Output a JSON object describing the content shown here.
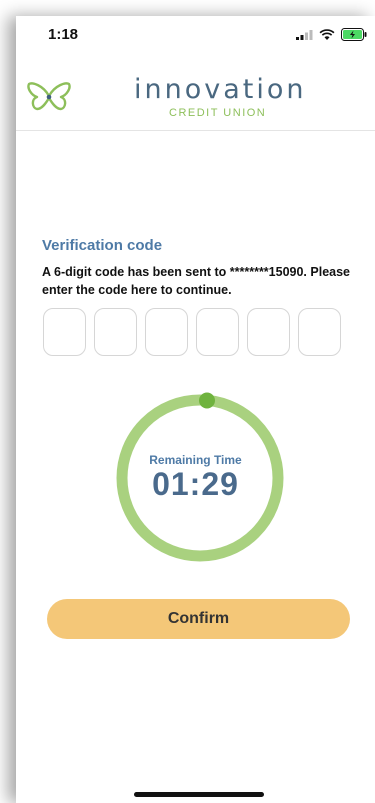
{
  "status": {
    "time": "1:18"
  },
  "brand": {
    "name": "innovation",
    "tagline": "CREDIT UNION",
    "colors": {
      "accent_green": "#8dbf5a",
      "navy": "#4a6880"
    }
  },
  "verification": {
    "title": "Verification code",
    "message": "A 6-digit code has been sent to ********15090. Please enter the code here to continue.",
    "digits": [
      "",
      "",
      "",
      "",
      "",
      ""
    ]
  },
  "timer": {
    "label": "Remaining Time",
    "value": "01:29",
    "ring_color": "#a9d17f",
    "knob_color": "#6fb33e"
  },
  "actions": {
    "confirm_label": "Confirm",
    "confirm_color": "#f4c778"
  },
  "icons": [
    "signal-icon",
    "wifi-icon",
    "battery-icon",
    "butterfly-icon"
  ]
}
